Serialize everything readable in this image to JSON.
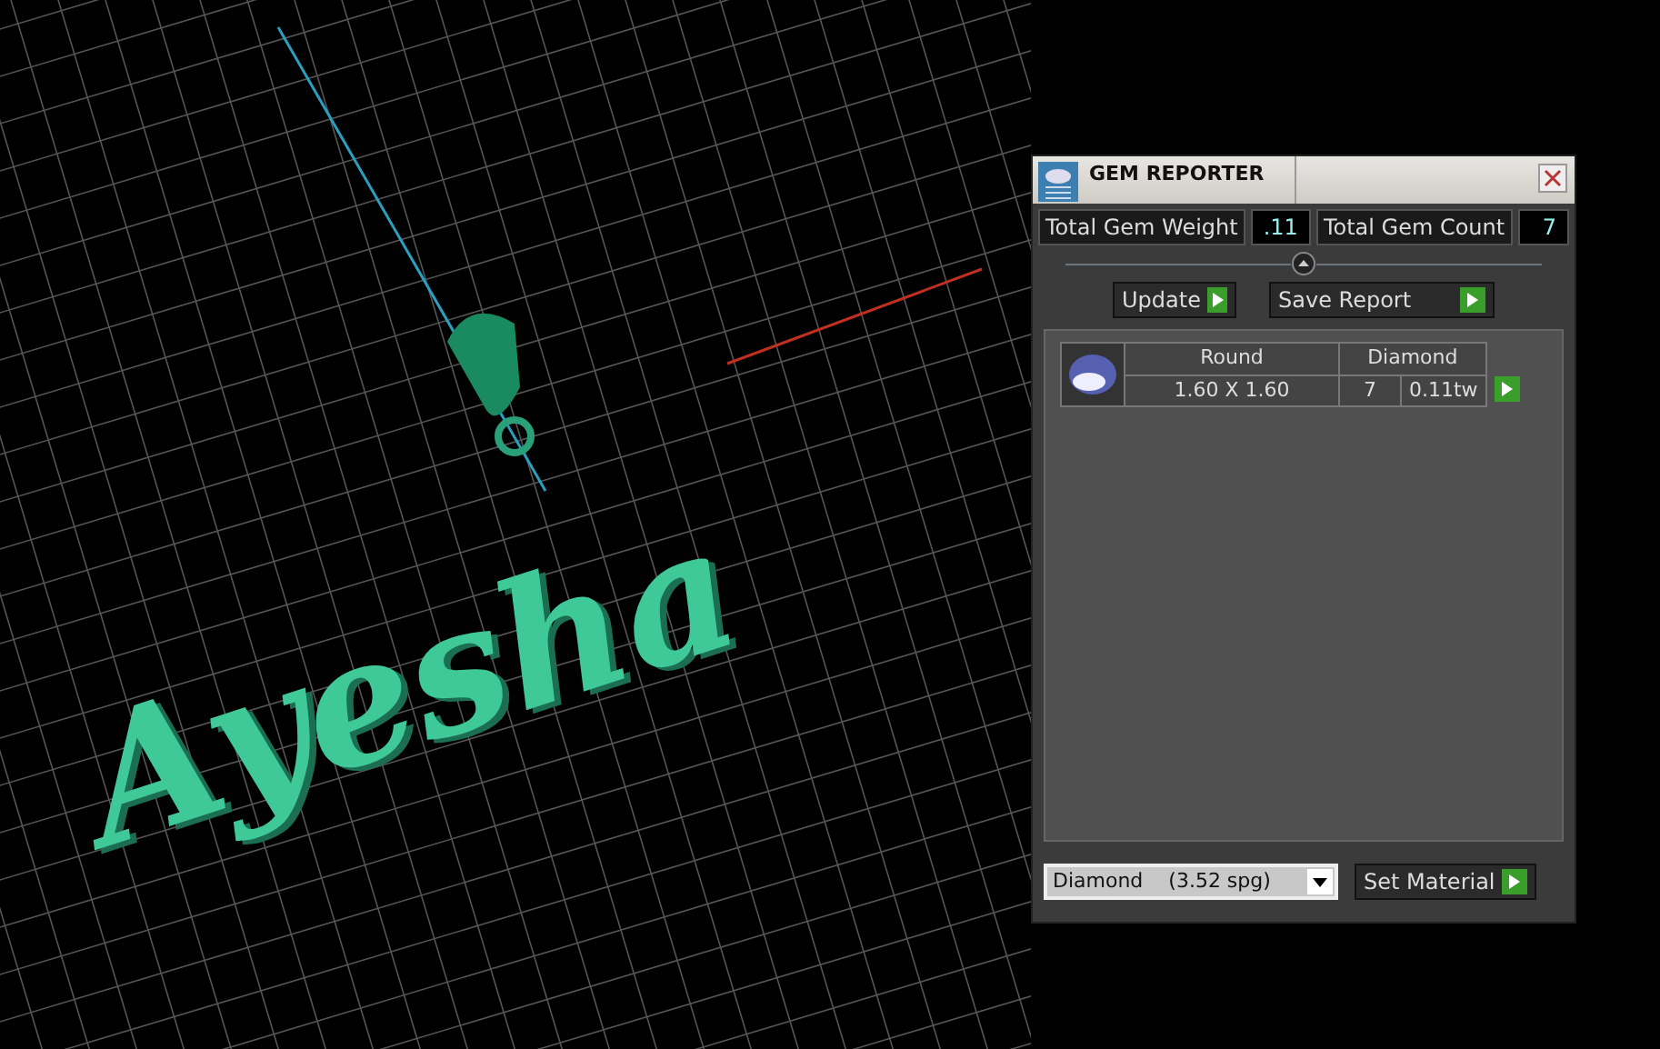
{
  "viewport": {
    "model_text": "Ayesha"
  },
  "gem_reporter": {
    "title": "GEM REPORTER",
    "total_weight": {
      "label": "Total Gem Weight",
      "value": ".11"
    },
    "total_count": {
      "label": "Total Gem Count",
      "value": "7"
    },
    "buttons": [
      {
        "label": "Update",
        "kind": "short"
      },
      {
        "label": "Save Report",
        "kind": "long"
      }
    ],
    "gems": [
      {
        "shape": "Round",
        "material": "Diamond",
        "size": "1.60 X 1.60",
        "count": "7",
        "weight": "0.11tw"
      }
    ],
    "material_select": {
      "value": "Diamond    (3.52 spg)"
    },
    "set_button": {
      "label": "Set Material"
    }
  }
}
